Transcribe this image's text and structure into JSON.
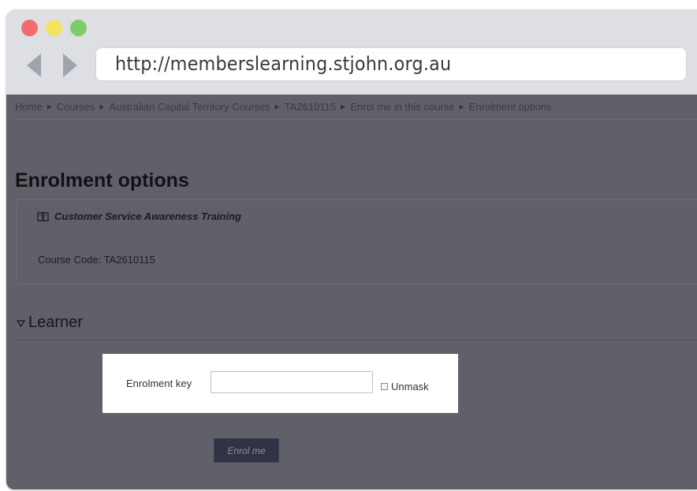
{
  "browser": {
    "url": "http://memberslearning.stjohn.org.au"
  },
  "breadcrumb": [
    "Home",
    "Courses",
    "Australian Capital Territory Courses",
    "TA2610115",
    "Enrol me in this course",
    "Enrolment options"
  ],
  "page": {
    "title": "Enrolment options"
  },
  "course": {
    "name": "Customer Service Awareness Training",
    "code_text": "Course Code: TA2610115"
  },
  "section": {
    "title": "Learner"
  },
  "form": {
    "key_label": "Enrolment key",
    "key_value": "",
    "unmask_label": "Unmask",
    "submit_label": "Enrol me"
  },
  "colors": {
    "overlay": "#5f6068",
    "button": "#2f3344"
  }
}
